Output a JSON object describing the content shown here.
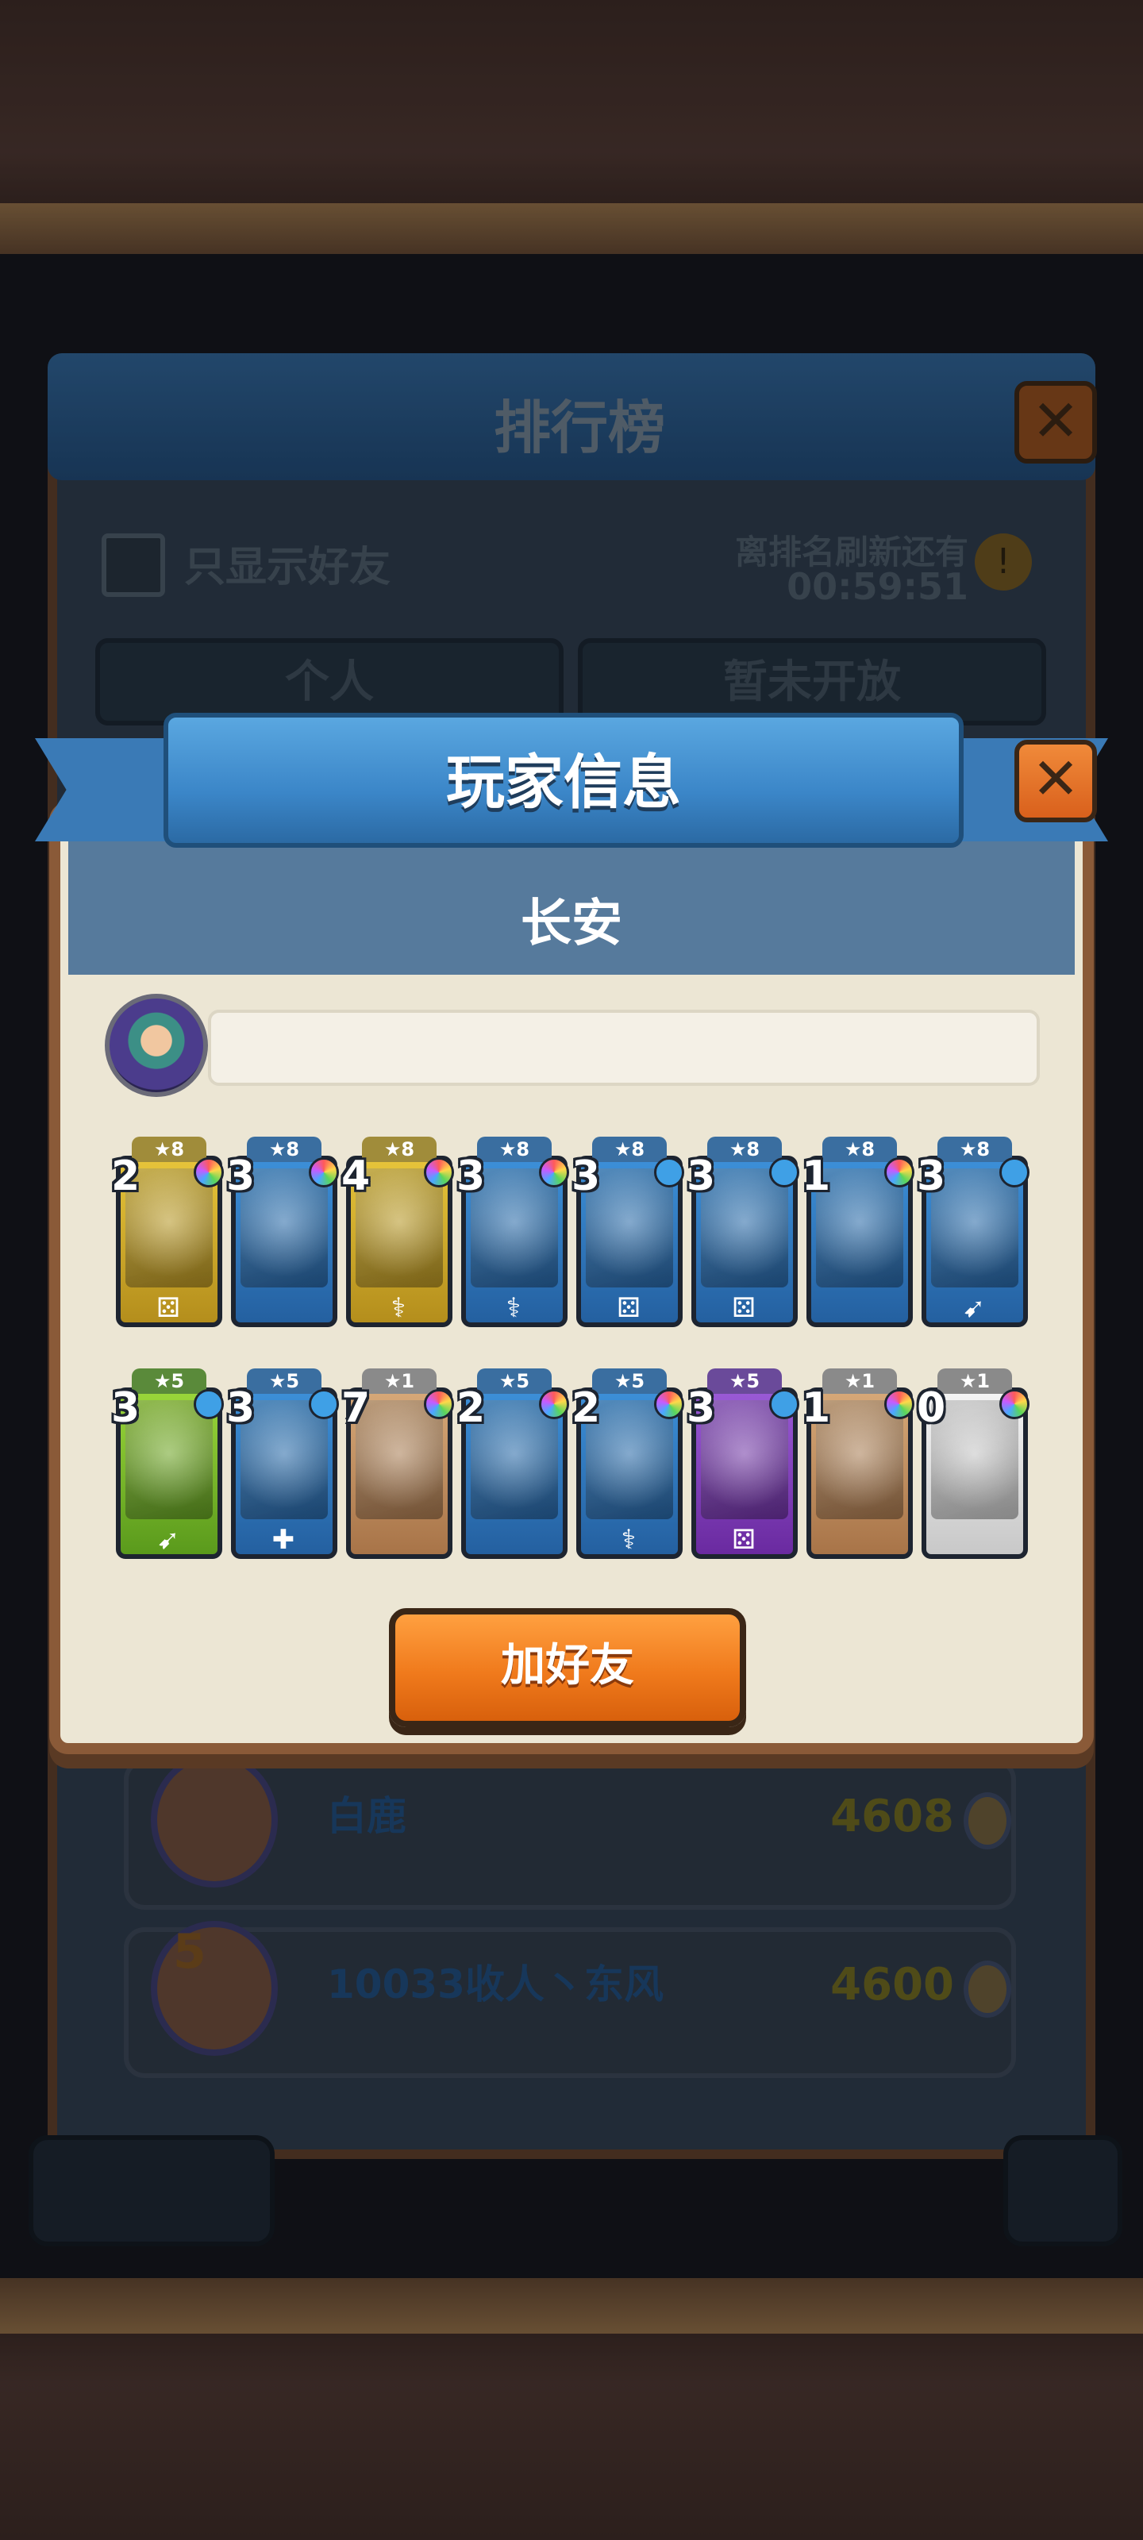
{
  "leaderboard": {
    "title": "排行榜",
    "close_icon": "close-icon",
    "friends_only_label": "只显示好友",
    "refresh_label": "离排名刷新还有",
    "refresh_time": "00:59:51",
    "tabs": [
      {
        "label": "个人"
      },
      {
        "label": "暂未开放"
      }
    ],
    "rows": [
      {
        "name": "白鹿",
        "score": "4608",
        "rank": ""
      },
      {
        "name": "10033收人丶东风",
        "score": "4600",
        "rank": "5"
      }
    ]
  },
  "player_info": {
    "title": "玩家信息",
    "close_icon": "close-icon",
    "player_name": "长安",
    "signature": "",
    "avatar_icon": "hooded-character-avatar-icon",
    "add_friend_label": "加好友",
    "cards": [
      {
        "stars": "★8",
        "level": "2",
        "color": "gold",
        "gem": "rainbow",
        "tag": "dice-icon",
        "tag_glyph": "⚄"
      },
      {
        "stars": "★8",
        "level": "3",
        "color": "blue",
        "gem": "rainbow",
        "tag": "",
        "tag_glyph": ""
      },
      {
        "stars": "★8",
        "level": "4",
        "color": "gold",
        "gem": "rainbow",
        "tag": "staff-icon",
        "tag_glyph": "⚕"
      },
      {
        "stars": "★8",
        "level": "3",
        "color": "blue",
        "gem": "rainbow",
        "tag": "staff-icon",
        "tag_glyph": "⚕"
      },
      {
        "stars": "★8",
        "level": "3",
        "color": "blue",
        "gem": "blue",
        "tag": "dice-icon",
        "tag_glyph": "⚄"
      },
      {
        "stars": "★8",
        "level": "3",
        "color": "blue",
        "gem": "blue",
        "tag": "dice-icon",
        "tag_glyph": "⚄"
      },
      {
        "stars": "★8",
        "level": "1",
        "color": "blue",
        "gem": "rainbow",
        "tag": "",
        "tag_glyph": ""
      },
      {
        "stars": "★8",
        "level": "3",
        "color": "blue",
        "gem": "blue",
        "tag": "bow-icon",
        "tag_glyph": "➹"
      },
      {
        "stars": "★5",
        "level": "3",
        "color": "green",
        "gem": "blue",
        "tag": "bow-icon",
        "tag_glyph": "➹"
      },
      {
        "stars": "★5",
        "level": "3",
        "color": "blue",
        "gem": "blue",
        "tag": "heal-icon",
        "tag_glyph": "✚"
      },
      {
        "stars": "★1",
        "level": "7",
        "color": "tan",
        "gem": "rainbow",
        "tag": "",
        "tag_glyph": ""
      },
      {
        "stars": "★5",
        "level": "2",
        "color": "blue",
        "gem": "rainbow",
        "tag": "",
        "tag_glyph": ""
      },
      {
        "stars": "★5",
        "level": "2",
        "color": "blue",
        "gem": "rainbow",
        "tag": "staff-icon",
        "tag_glyph": "⚕"
      },
      {
        "stars": "★5",
        "level": "3",
        "color": "purple",
        "gem": "blue",
        "tag": "dice-icon",
        "tag_glyph": "⚄"
      },
      {
        "stars": "★1",
        "level": "1",
        "color": "tan",
        "gem": "rainbow",
        "tag": "",
        "tag_glyph": ""
      },
      {
        "stars": "★1",
        "level": "0",
        "color": "white",
        "gem": "rainbow",
        "tag": "",
        "tag_glyph": ""
      }
    ]
  },
  "colors": {
    "ribbon_blue": "#3b86c8",
    "name_band": "#567a9c",
    "button_orange": "#f07a1c",
    "dialog_paper": "#ece6d4"
  }
}
